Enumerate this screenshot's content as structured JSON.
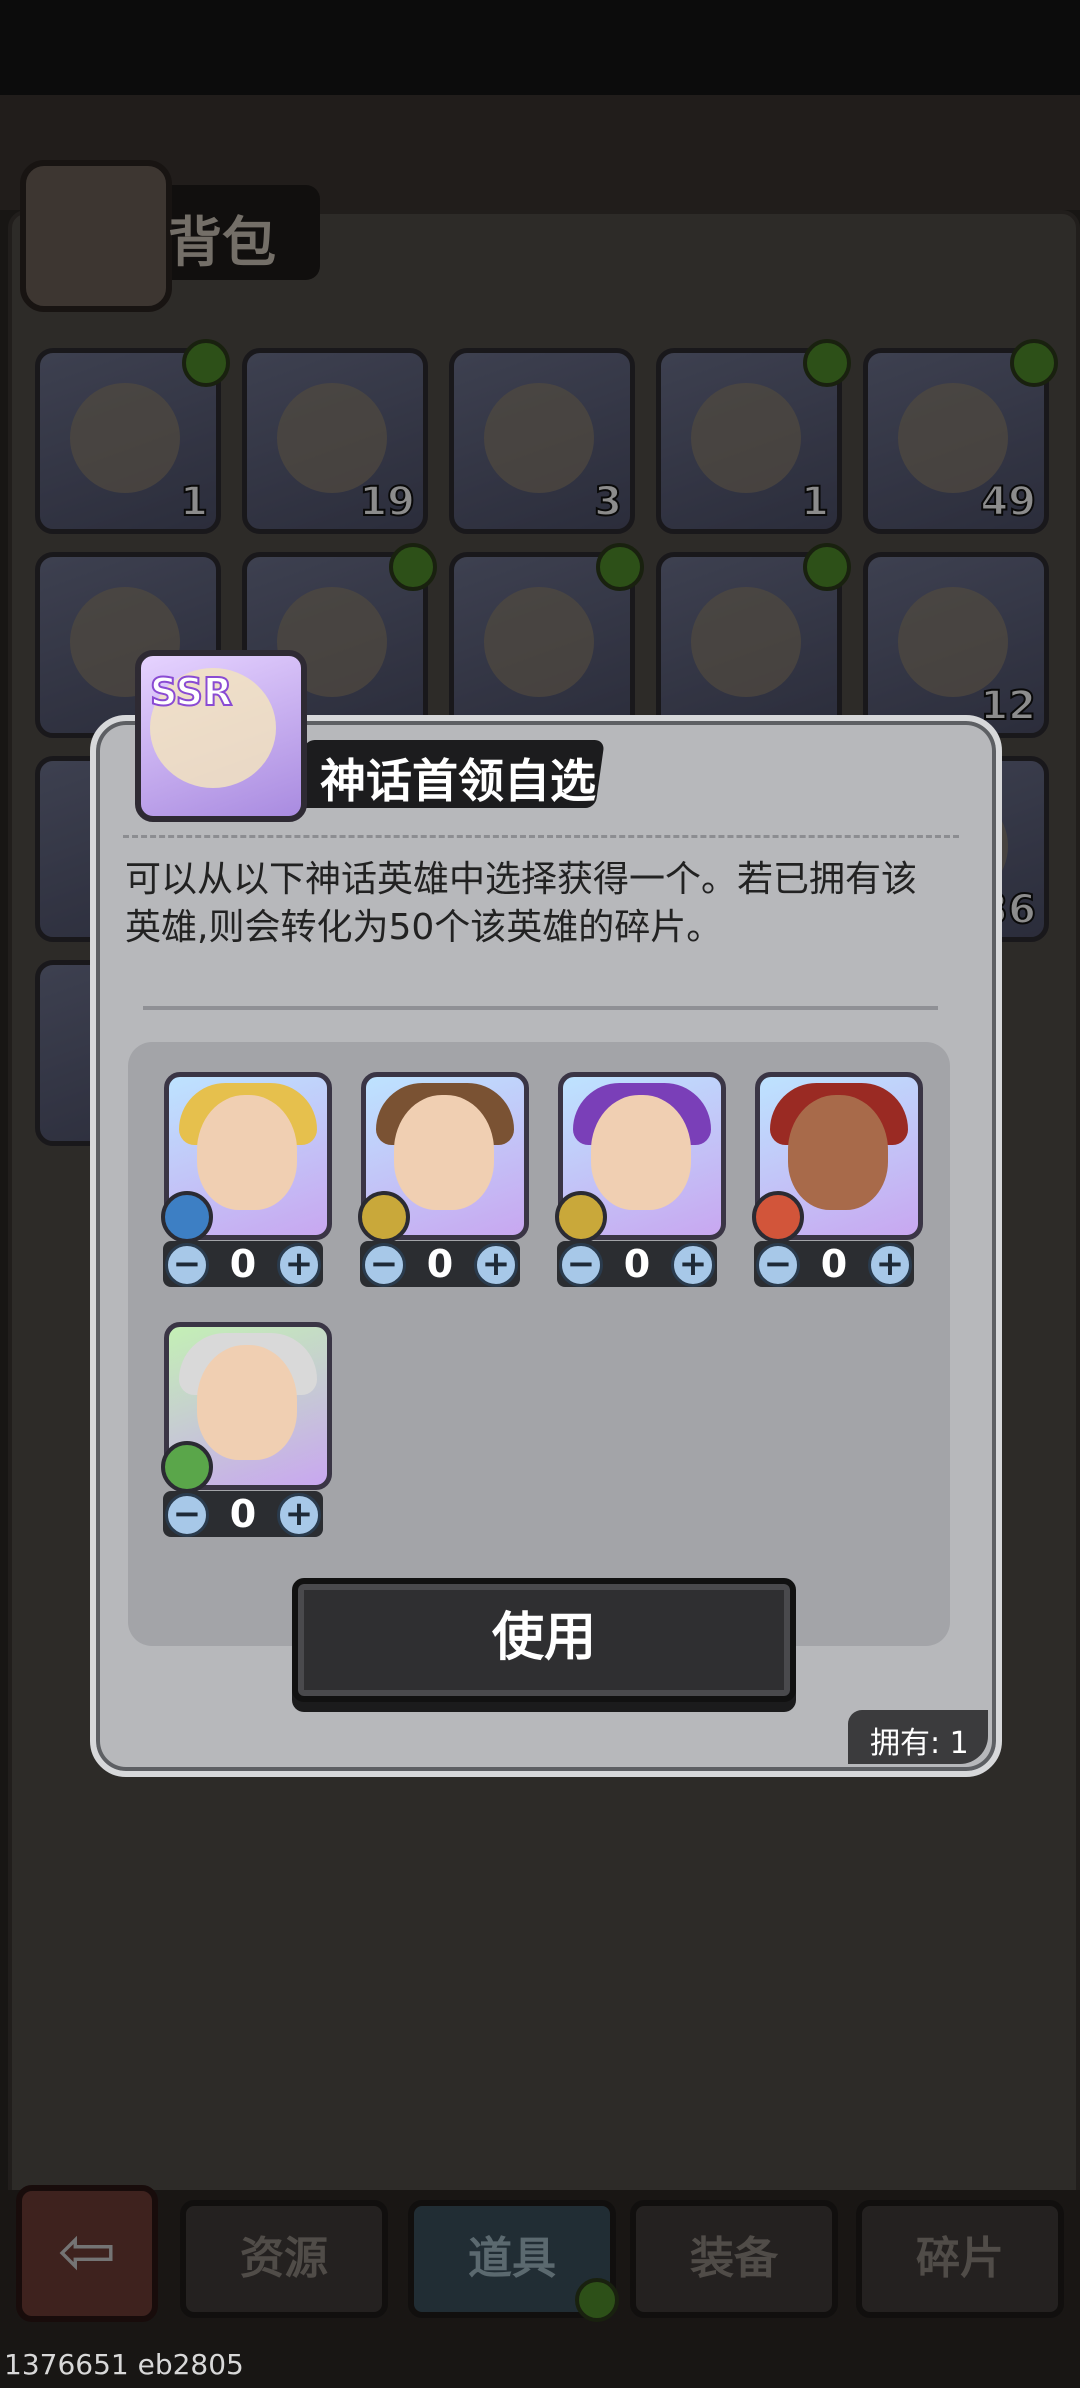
{
  "bag": {
    "title": "背包",
    "grid": [
      {
        "count": "1",
        "badge": true
      },
      {
        "count": "19",
        "badge": false
      },
      {
        "count": "3",
        "badge": false
      },
      {
        "count": "1",
        "badge": true
      },
      {
        "count": "49",
        "badge": true
      },
      {
        "count": "",
        "badge": false
      },
      {
        "count": "",
        "badge": true
      },
      {
        "count": "",
        "badge": true
      },
      {
        "count": "",
        "badge": true
      },
      {
        "count": "12",
        "badge": false
      },
      {
        "count": "36",
        "badge": false
      }
    ]
  },
  "tabs": {
    "resources": "资源",
    "items": "道具",
    "equipment": "装备",
    "fragments": "碎片",
    "active": "items"
  },
  "modal": {
    "title": "神话首领自选",
    "item_badge": "SSR",
    "description_line1": "可以从以下神话英雄中选择获得一个。若已拥有该",
    "description_line2": "英雄,则会转化为50个该英雄的碎片。",
    "heroes": [
      {
        "element": "water-icon",
        "quantity": "0"
      },
      {
        "element": "earth-icon",
        "quantity": "0"
      },
      {
        "element": "earth-icon",
        "quantity": "0"
      },
      {
        "element": "fire-icon",
        "quantity": "0"
      },
      {
        "element": "wind-icon",
        "quantity": "0"
      }
    ],
    "use_button": "使用",
    "owned": "拥有: 1"
  },
  "footer": {
    "build_id": "1376651 eb2805"
  },
  "colors": {
    "accent_green": "#4e8b2a",
    "stepper_button": "#a7c8e8",
    "modal_bg": "#b7b8bb"
  }
}
